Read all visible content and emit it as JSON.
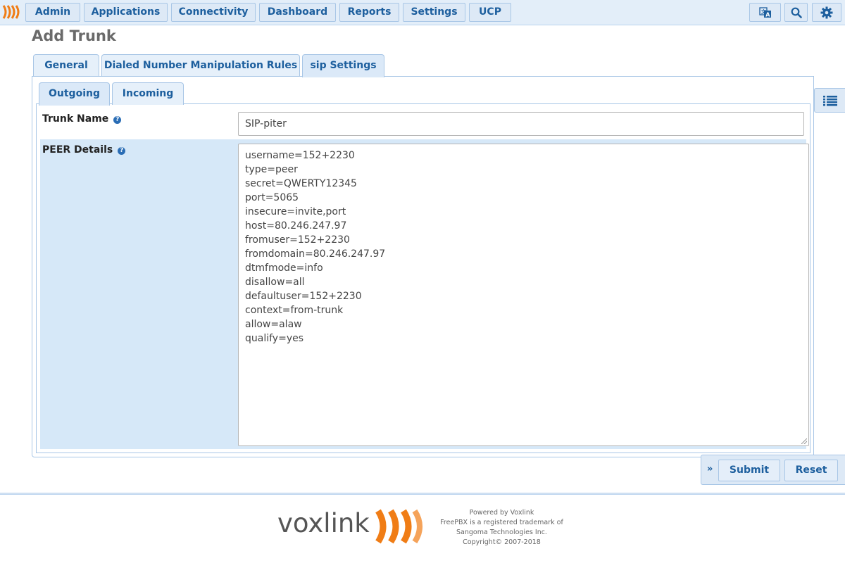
{
  "nav": {
    "items": [
      "Admin",
      "Applications",
      "Connectivity",
      "Dashboard",
      "Reports",
      "Settings",
      "UCP"
    ]
  },
  "page": {
    "title": "Add Trunk"
  },
  "tabs": {
    "main": [
      "General",
      "Dialed Number Manipulation Rules",
      "sip Settings"
    ],
    "sub": [
      "Outgoing",
      "Incoming"
    ]
  },
  "form": {
    "trunk_name_label": "Trunk Name",
    "trunk_name_value": "SIP-piter",
    "peer_details_label": "PEER Details",
    "peer_details_lines": [
      "username=152+2230",
      "type=peer",
      "secret=QWERTY12345",
      "port=5065",
      "insecure=invite,port",
      "host=80.246.247.97",
      "fromuser=152+2230",
      "fromdomain=80.246.247.97",
      "dtmfmode=info",
      "disallow=all",
      "defaultuser=152+2230",
      "context=from-trunk",
      "allow=alaw",
      "qualify=yes"
    ]
  },
  "actions": {
    "submit": "Submit",
    "reset": "Reset"
  },
  "footer": {
    "brand": "voxlink",
    "line1": "Powered by Voxlink",
    "line2": "FreePBX is a registered trademark of",
    "line3": "Sangoma Technologies Inc.",
    "line4": "Copyright© 2007-2018"
  },
  "colors": {
    "accent": "#1d5f9e",
    "brand_orange": "#f07d16"
  }
}
